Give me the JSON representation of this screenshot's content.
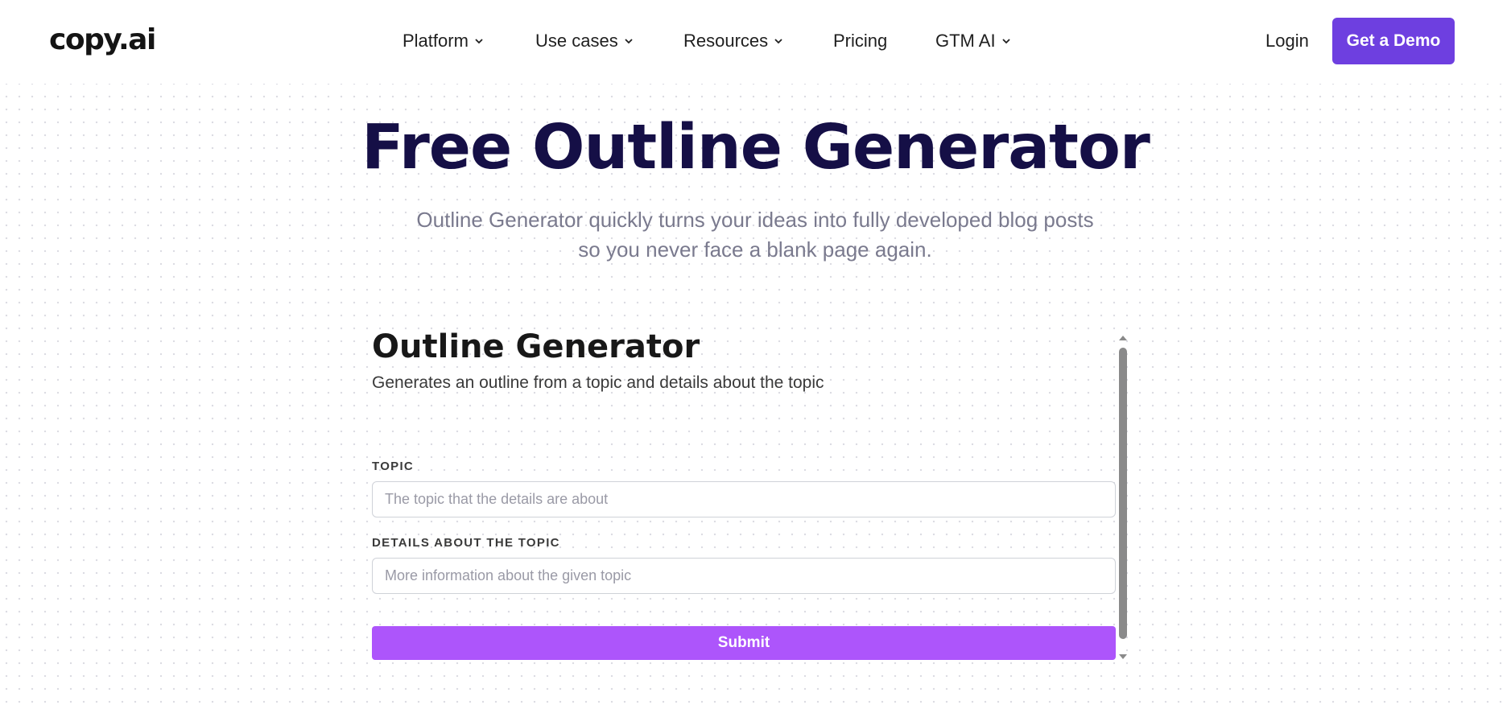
{
  "header": {
    "logo": "copy.ai",
    "nav": [
      {
        "label": "Platform",
        "has_dropdown": true
      },
      {
        "label": "Use cases",
        "has_dropdown": true
      },
      {
        "label": "Resources",
        "has_dropdown": true
      },
      {
        "label": "Pricing",
        "has_dropdown": false
      },
      {
        "label": "GTM AI",
        "has_dropdown": true
      }
    ],
    "login": "Login",
    "demo_button": "Get a Demo"
  },
  "hero": {
    "title": "Free Outline Generator",
    "subtitle_line1": "Outline Generator quickly turns your ideas into fully developed blog posts",
    "subtitle_line2": "so you never face a blank page again."
  },
  "tool": {
    "title": "Outline Generator",
    "description": "Generates an outline from a topic and details about the topic",
    "topic": {
      "label": "TOPIC",
      "placeholder": "The topic that the details are about",
      "value": ""
    },
    "details": {
      "label": "DETAILS ABOUT THE TOPIC",
      "placeholder": "More information about the given topic",
      "value": ""
    },
    "submit": "Submit"
  },
  "colors": {
    "brand_purple": "#6e3fe0",
    "submit_purple": "#ad55fb",
    "title_navy": "#150f46"
  }
}
